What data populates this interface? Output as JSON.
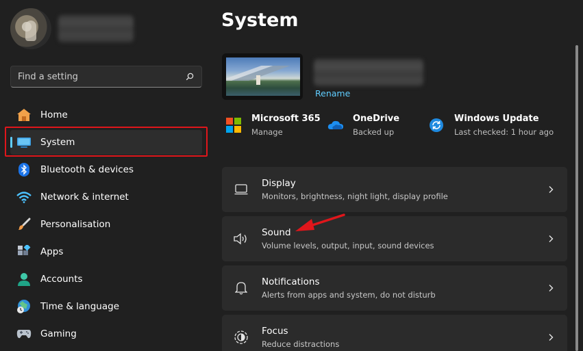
{
  "sidebar": {
    "search": {
      "placeholder": "Find a setting"
    },
    "items": [
      {
        "label": "Home",
        "icon": "home-icon"
      },
      {
        "label": "System",
        "icon": "monitor-icon",
        "selected": true
      },
      {
        "label": "Bluetooth & devices",
        "icon": "bluetooth-icon"
      },
      {
        "label": "Network & internet",
        "icon": "wifi-icon"
      },
      {
        "label": "Personalisation",
        "icon": "paintbrush-icon"
      },
      {
        "label": "Apps",
        "icon": "apps-icon"
      },
      {
        "label": "Accounts",
        "icon": "person-icon"
      },
      {
        "label": "Time & language",
        "icon": "globe-clock-icon"
      },
      {
        "label": "Gaming",
        "icon": "gamepad-icon"
      }
    ]
  },
  "main": {
    "title": "System",
    "device": {
      "rename_label": "Rename"
    },
    "quick_links": [
      {
        "title": "Microsoft 365",
        "subtitle": "Manage",
        "icon": "microsoft-365-icon"
      },
      {
        "title": "OneDrive",
        "subtitle": "Backed up",
        "icon": "onedrive-cloud-icon"
      },
      {
        "title": "Windows Update",
        "subtitle": "Last checked: 1 hour ago",
        "icon": "windows-update-icon"
      }
    ],
    "settings": [
      {
        "title": "Display",
        "subtitle": "Monitors, brightness, night light, display profile",
        "icon": "display-icon"
      },
      {
        "title": "Sound",
        "subtitle": "Volume levels, output, input, sound devices",
        "icon": "speaker-icon"
      },
      {
        "title": "Notifications",
        "subtitle": "Alerts from apps and system, do not disturb",
        "icon": "bell-icon"
      },
      {
        "title": "Focus",
        "subtitle": "Reduce distractions",
        "icon": "focus-icon"
      }
    ]
  },
  "colors": {
    "background": "#202020",
    "card": "#2b2b2b",
    "accent": "#60cdff",
    "annotation_red": "#e0161b"
  }
}
